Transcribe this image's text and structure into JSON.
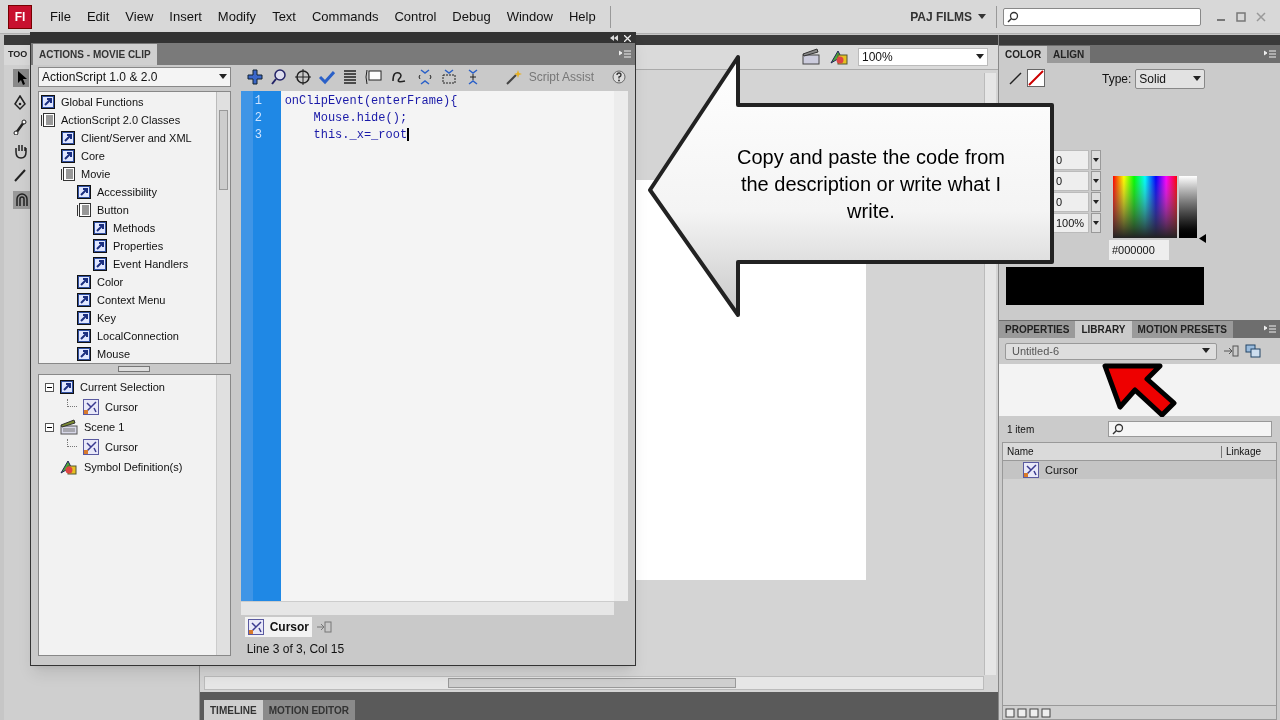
{
  "menu_bar": {
    "logo": "Fl",
    "items": [
      "File",
      "Edit",
      "View",
      "Insert",
      "Modify",
      "Text",
      "Commands",
      "Control",
      "Debug",
      "Window",
      "Help"
    ],
    "workspace": "PAJ FILMS"
  },
  "tools_panel": {
    "title": "TOO"
  },
  "actions_panel": {
    "title": "ACTIONS - MOVIE CLIP",
    "version": "ActionScript 1.0 & 2.0",
    "script_assist": "Script Assist",
    "toolbox": [
      {
        "label": "Global Functions",
        "kind": "item"
      },
      {
        "label": "ActionScript 2.0 Classes",
        "kind": "book",
        "children": [
          {
            "label": "Client/Server and XML",
            "kind": "item"
          },
          {
            "label": "Core",
            "kind": "item"
          },
          {
            "label": "Movie",
            "kind": "book",
            "children": [
              {
                "label": "Accessibility",
                "kind": "item"
              },
              {
                "label": "Button",
                "kind": "book",
                "children": [
                  {
                    "label": "Methods",
                    "kind": "item"
                  },
                  {
                    "label": "Properties",
                    "kind": "item"
                  },
                  {
                    "label": "Event Handlers",
                    "kind": "item"
                  }
                ]
              },
              {
                "label": "Color",
                "kind": "item"
              },
              {
                "label": "Context Menu",
                "kind": "item"
              },
              {
                "label": "Key",
                "kind": "item"
              },
              {
                "label": "LocalConnection",
                "kind": "item"
              },
              {
                "label": "Mouse",
                "kind": "item"
              }
            ]
          }
        ]
      }
    ],
    "navigator": [
      {
        "label": "Current Selection",
        "kind": "item",
        "expanded": true,
        "children": [
          {
            "label": "Cursor",
            "kind": "symbol"
          }
        ]
      },
      {
        "label": "Scene 1",
        "kind": "scene",
        "expanded": true,
        "children": [
          {
            "label": "Cursor",
            "kind": "symbol"
          }
        ]
      },
      {
        "label": "Symbol Definition(s)",
        "kind": "definition"
      }
    ],
    "code_lines": [
      {
        "number": "1",
        "text": "onClipEvent(enterFrame){"
      },
      {
        "number": "2",
        "text": "    Mouse.hide();"
      },
      {
        "number": "3",
        "text": "    this._x=_root"
      }
    ],
    "script_tab": "Cursor",
    "status": "Line 3 of 3, Col 15"
  },
  "stage": {
    "zoom": "100%"
  },
  "color_panel": {
    "tabs": [
      {
        "label": "COLOR",
        "selected": true
      },
      {
        "label": "ALIGN",
        "selected": false
      }
    ],
    "type_label": "Type:",
    "type": "Solid",
    "fields": [
      "0",
      "0",
      "0",
      "100%"
    ],
    "brightness": {
      "level": 0
    },
    "hex": "#000000"
  },
  "library_panel": {
    "tabs": [
      {
        "label": "PROPERTIES",
        "selected": false
      },
      {
        "label": "LIBRARY",
        "selected": true
      },
      {
        "label": "MOTION PRESETS",
        "selected": false
      }
    ],
    "document": "Untitled-6",
    "count": "1 item",
    "columns": [
      "Name",
      "Linkage"
    ],
    "items": [
      {
        "label": "Cursor",
        "selected": true
      }
    ]
  },
  "timeline_tabs": [
    {
      "label": "TIMELINE",
      "selected": true
    },
    {
      "label": "MOTION EDITOR",
      "selected": false
    }
  ],
  "callout": {
    "text": "Copy and paste the code from the description or write what I write."
  }
}
